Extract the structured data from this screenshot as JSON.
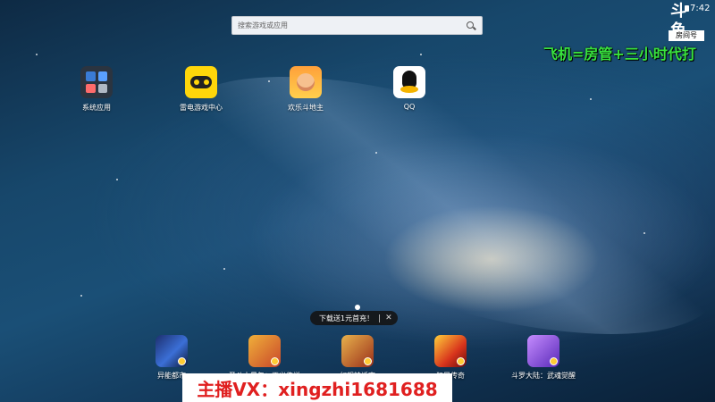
{
  "search": {
    "placeholder": "搜索游戏或应用"
  },
  "status": {
    "time": "7:42"
  },
  "overlay": {
    "logo_main": "斗鱼",
    "logo_sub": "房间号",
    "promo_text": "飞机=房管+三小时代打",
    "streamer_contact": "主播VX：xingzhi1681688"
  },
  "desktop_apps": [
    {
      "label": "系统应用",
      "icon": "system-apps-icon"
    },
    {
      "label": "雷电游戏中心",
      "icon": "gamepad-icon"
    },
    {
      "label": "欢乐斗地主",
      "icon": "landlord-icon"
    },
    {
      "label": "QQ",
      "icon": "qq-penguin-icon"
    }
  ],
  "toast": {
    "text": "下载送1元首充！"
  },
  "dock_apps": [
    {
      "label": "异能都市",
      "icon": "game-icon"
    },
    {
      "label": "圣斗士星矢：正义传说",
      "icon": "game-icon"
    },
    {
      "label": "幻想神话志",
      "icon": "game-icon"
    },
    {
      "label": "狂暴传奇",
      "icon": "game-icon"
    },
    {
      "label": "斗罗大陆：武魂觉醒",
      "icon": "game-icon"
    }
  ],
  "colors": {
    "promo_green": "#38e23e",
    "streamer_red": "#e02020",
    "wallpaper_dark": "#0e2a44"
  }
}
